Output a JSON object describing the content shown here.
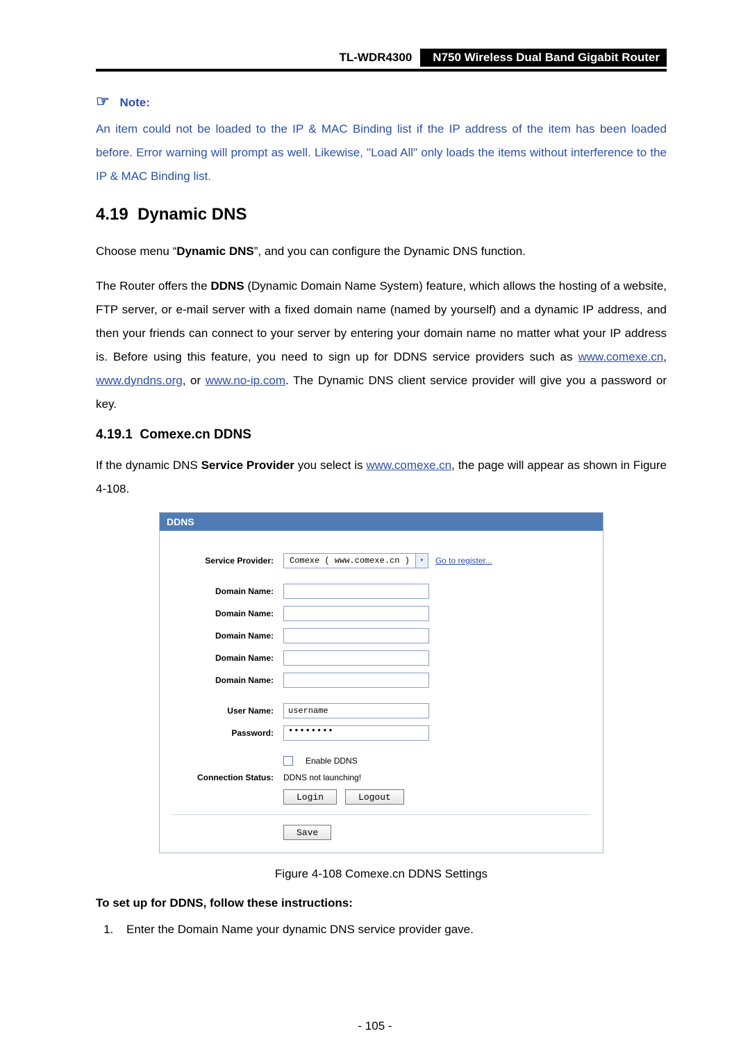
{
  "header": {
    "model": "TL-WDR4300",
    "product": "N750 Wireless Dual Band Gigabit Router"
  },
  "note": {
    "label": "Note:",
    "body": "An item could not be loaded to the IP & MAC Binding list if the IP address of the item has been loaded before. Error warning will prompt as well. Likewise, \"Load All\" only loads the items without interference to the IP & MAC Binding list."
  },
  "section": {
    "number": "4.19",
    "title": "Dynamic DNS"
  },
  "intro1_pre": "Choose menu “",
  "intro1_bold": "Dynamic DNS",
  "intro1_post": "”, and you can configure the Dynamic DNS function.",
  "intro2": {
    "pre": "The Router offers the ",
    "bold1": "DDNS",
    "mid1": " (Dynamic Domain Name System) feature, which allows the hosting of a website, FTP server, or e-mail server with a fixed domain name (named by yourself) and a dynamic IP address, and then your friends can connect to your server by entering your domain name no matter what your IP address is. Before using this feature, you need to sign up for DDNS service providers such as ",
    "link1": "www.comexe.cn",
    "sep1": ", ",
    "link2": "www.dyndns.org",
    "sep2": ", or ",
    "link3": "www.no-ip.com",
    "post": ". The Dynamic DNS client service provider will give you a password or key."
  },
  "subsection": {
    "number": "4.19.1",
    "title": "Comexe.cn DDNS"
  },
  "subintro": {
    "pre": "If the dynamic DNS ",
    "bold": "Service Provider",
    "mid": " you select is ",
    "link": "www.comexe.cn",
    "post": ", the page will appear as shown in Figure 4-108."
  },
  "ddns": {
    "title": "DDNS",
    "labels": {
      "service_provider": "Service Provider:",
      "domain_name": "Domain Name:",
      "user_name": "User Name:",
      "password": "Password:",
      "connection_status": "Connection Status:"
    },
    "service_provider_value": "Comexe ( www.comexe.cn )",
    "register_link": "Go to register...",
    "domain_values": [
      "",
      "",
      "",
      "",
      ""
    ],
    "user_name_value": "username",
    "password_value": "••••••••",
    "enable_label": "Enable DDNS",
    "enable_checked": false,
    "status_text": "DDNS not launching!",
    "buttons": {
      "login": "Login",
      "logout": "Logout",
      "save": "Save"
    }
  },
  "figure_caption": "Figure 4-108 Comexe.cn DDNS Settings",
  "setup_heading": "To set up for DDNS, follow these instructions:",
  "steps": {
    "s1_pre": "Enter the ",
    "s1_bold": "Domain Name",
    "s1_post": " your dynamic DNS service provider gave."
  },
  "page_number": "- 105 -"
}
